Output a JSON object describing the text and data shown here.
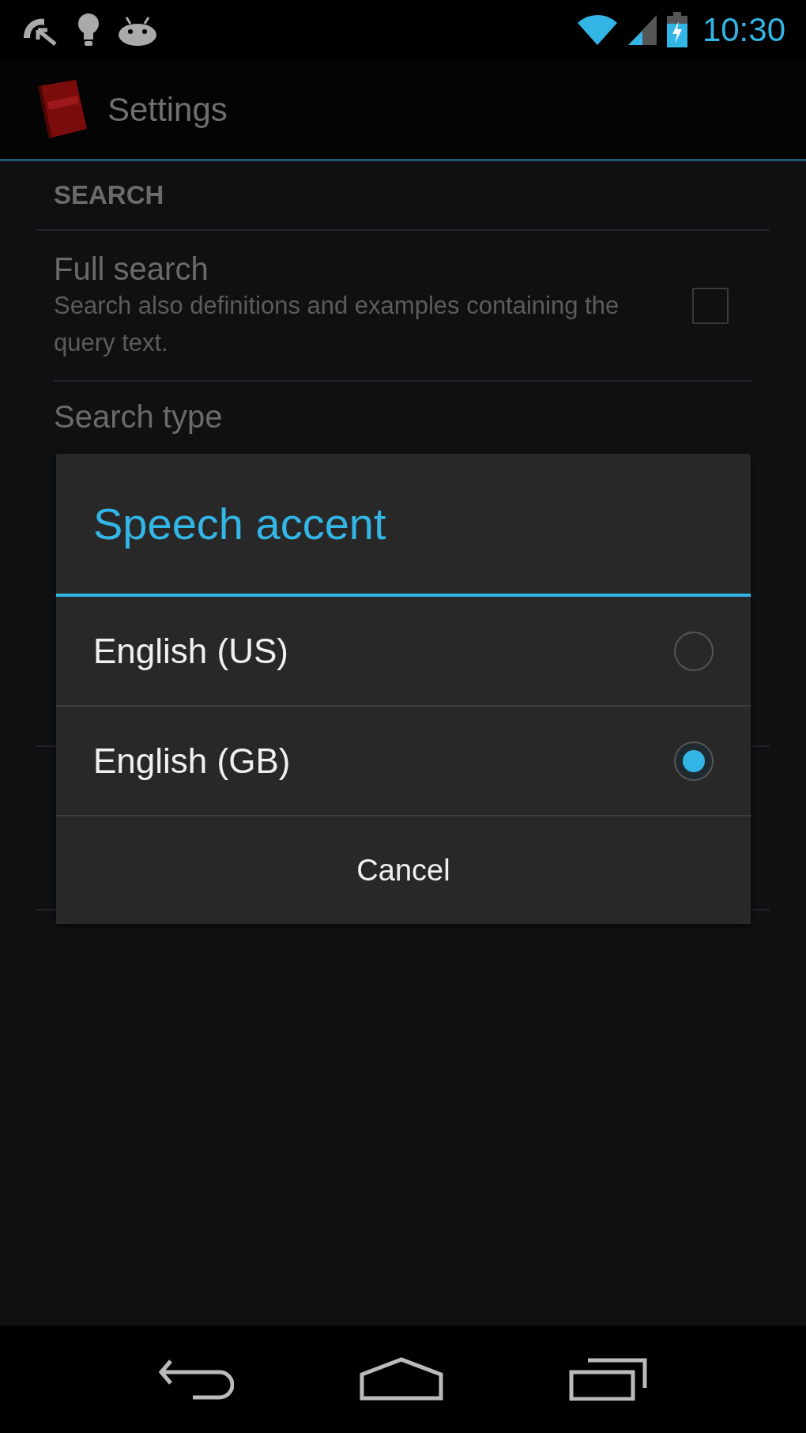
{
  "status_bar": {
    "time": "10:30"
  },
  "action_bar": {
    "title": "Settings"
  },
  "preferences": {
    "category": "SEARCH",
    "items": [
      {
        "kind": "checkbox",
        "title": "Full search",
        "summary": "Search also definitions and examples containing the query text.",
        "checked": false
      },
      {
        "kind": "list",
        "title": "Search type"
      }
    ]
  },
  "dialog": {
    "title": "Speech accent",
    "options": [
      {
        "label": "English (US)",
        "selected": false
      },
      {
        "label": "English (GB)",
        "selected": true
      }
    ],
    "buttons": [
      "Cancel"
    ]
  }
}
